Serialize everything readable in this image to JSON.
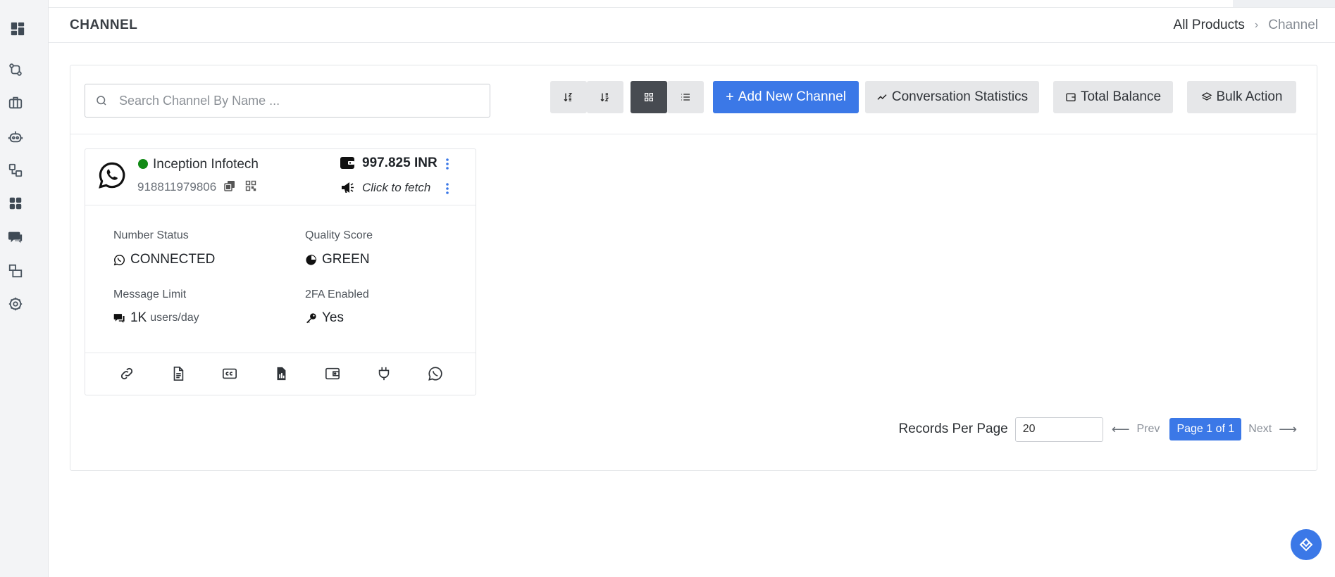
{
  "sidebar": {
    "icons": [
      "dashboard-icon",
      "git-compare-icon",
      "briefcase-icon",
      "bot-icon",
      "workflow-icon",
      "apps-icon",
      "chat-icon",
      "template-icon",
      "settings-icon"
    ]
  },
  "header": {
    "title": "CHANNEL",
    "breadcrumb": [
      "All Products",
      "Channel"
    ],
    "breadcrumb_sep": "›"
  },
  "toolbar": {
    "search_placeholder": "Search Channel By Name ...",
    "add_label": "Add New Channel",
    "add_prefix": "+",
    "stats_label": "Conversation Statistics",
    "balance_label": "Total Balance",
    "bulk_label": "Bulk Action"
  },
  "channel": {
    "name": "Inception Infotech",
    "phone": "918811979806",
    "status_color": "#128a16",
    "balance": "997.825 INR",
    "fetch_label": "Click to fetch",
    "number_status_label": "Number Status",
    "number_status_value": "CONNECTED",
    "quality_label": "Quality Score",
    "quality_value": "GREEN",
    "limit_label": "Message Limit",
    "limit_value": "1K",
    "limit_unit": "users/day",
    "twofa_label": "2FA Enabled",
    "twofa_value": "Yes",
    "footer_icons": [
      "link-icon",
      "document-icon",
      "cc-card-icon",
      "report-icon",
      "wallet-icon",
      "plug-icon",
      "whatsapp-icon"
    ]
  },
  "pagination": {
    "records_label": "Records Per Page",
    "records_value": "20",
    "prev_label": "Prev",
    "page_label": "Page 1 of 1",
    "next_label": "Next"
  },
  "colors": {
    "accent": "#3b78e7",
    "dark_button": "#474b51",
    "status_green": "#128a16"
  }
}
